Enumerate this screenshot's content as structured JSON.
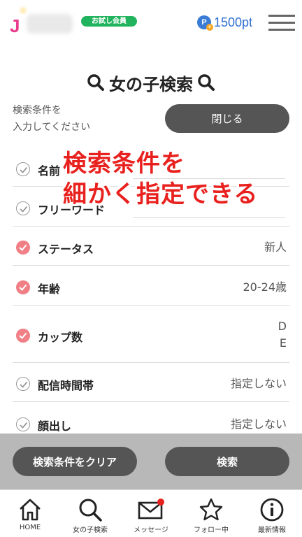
{
  "header": {
    "logo_letter": "J",
    "badge": "お試し会員",
    "points_icon": "P",
    "points": "1500pt"
  },
  "title": "女の子検索",
  "prompt": {
    "line1": "検索条件を",
    "line2": "入力してください"
  },
  "close_button": "閉じる",
  "rows": [
    {
      "label": "名前",
      "value": "",
      "checked": false
    },
    {
      "label": "フリーワード",
      "value": "",
      "checked": false
    },
    {
      "label": "ステータス",
      "value": "新人",
      "checked": true
    },
    {
      "label": "年齢",
      "value": "20-24歳",
      "checked": true
    },
    {
      "label": "カップ数",
      "value_lines": [
        "D",
        "E"
      ],
      "checked": true
    },
    {
      "label": "配信時間帯",
      "value": "指定しない",
      "checked": false
    },
    {
      "label": "顔出し",
      "value": "指定しない",
      "checked": false
    }
  ],
  "annotation": {
    "line1": "検索条件を",
    "line2": "細かく指定できる"
  },
  "actions": {
    "clear": "検索条件をクリア",
    "search": "検索"
  },
  "bottom_nav": [
    {
      "label": "HOME",
      "icon": "home-icon"
    },
    {
      "label": "女の子検索",
      "icon": "search-icon"
    },
    {
      "label": "メッセージ",
      "icon": "envelope-icon"
    },
    {
      "label": "フォロー中",
      "icon": "star-icon"
    },
    {
      "label": "最新情報",
      "icon": "info-icon"
    }
  ],
  "colors": {
    "accent_pink": "#f07f86",
    "badge_green": "#21b35d",
    "points_blue": "#2f6fd0",
    "button_dark": "#555555",
    "annotation_red": "#e8211e"
  }
}
